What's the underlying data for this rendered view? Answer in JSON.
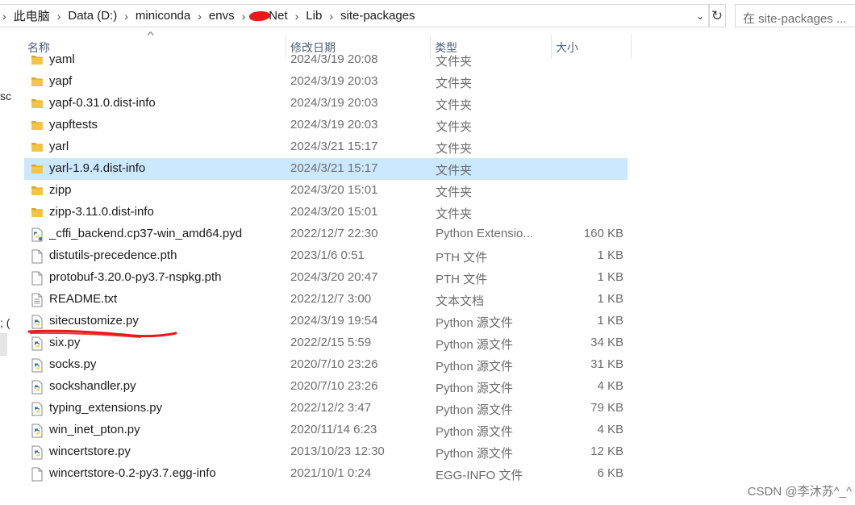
{
  "address_bar": {
    "crumbs": [
      "此电脑",
      "Data (D:)",
      "miniconda",
      "envs",
      "Net",
      "Lib",
      "site-packages"
    ]
  },
  "search": {
    "placeholder": "在 site-packages ..."
  },
  "columns": {
    "name": "名称",
    "date": "修改日期",
    "type": "类型",
    "size": "大小"
  },
  "left_nav_fragments": [
    "sc",
    "; ("
  ],
  "files": [
    {
      "name": "yaml",
      "date": "2024/3/19 20:08",
      "type": "文件夹",
      "size": "",
      "icon": "folder-icon"
    },
    {
      "name": "yapf",
      "date": "2024/3/19 20:03",
      "type": "文件夹",
      "size": "",
      "icon": "folder-icon"
    },
    {
      "name": "yapf-0.31.0.dist-info",
      "date": "2024/3/19 20:03",
      "type": "文件夹",
      "size": "",
      "icon": "folder-icon"
    },
    {
      "name": "yapftests",
      "date": "2024/3/19 20:03",
      "type": "文件夹",
      "size": "",
      "icon": "folder-icon"
    },
    {
      "name": "yarl",
      "date": "2024/3/21 15:17",
      "type": "文件夹",
      "size": "",
      "icon": "folder-icon"
    },
    {
      "name": "yarl-1.9.4.dist-info",
      "date": "2024/3/21 15:17",
      "type": "文件夹",
      "size": "",
      "icon": "folder-icon",
      "state": "hovered"
    },
    {
      "name": "zipp",
      "date": "2024/3/20 15:01",
      "type": "文件夹",
      "size": "",
      "icon": "folder-icon"
    },
    {
      "name": "zipp-3.11.0.dist-info",
      "date": "2024/3/20 15:01",
      "type": "文件夹",
      "size": "",
      "icon": "folder-icon"
    },
    {
      "name": "_cffi_backend.cp37-win_amd64.pyd",
      "date": "2022/12/7 22:30",
      "type": "Python Extensio...",
      "size": "160 KB",
      "icon": "python-extension-icon"
    },
    {
      "name": "distutils-precedence.pth",
      "date": "2023/1/6 0:51",
      "type": "PTH 文件",
      "size": "1 KB",
      "icon": "blank-file-icon"
    },
    {
      "name": "protobuf-3.20.0-py3.7-nspkg.pth",
      "date": "2024/3/20 20:47",
      "type": "PTH 文件",
      "size": "1 KB",
      "icon": "blank-file-icon"
    },
    {
      "name": "README.txt",
      "date": "2022/12/7 3:00",
      "type": "文本文档",
      "size": "1 KB",
      "icon": "text-file-icon"
    },
    {
      "name": "sitecustomize.py",
      "date": "2024/3/19 19:54",
      "type": "Python 源文件",
      "size": "1 KB",
      "icon": "python-file-icon"
    },
    {
      "name": "six.py",
      "date": "2022/2/15 5:59",
      "type": "Python 源文件",
      "size": "34 KB",
      "icon": "python-file-icon"
    },
    {
      "name": "socks.py",
      "date": "2020/7/10 23:26",
      "type": "Python 源文件",
      "size": "31 KB",
      "icon": "python-file-icon"
    },
    {
      "name": "sockshandler.py",
      "date": "2020/7/10 23:26",
      "type": "Python 源文件",
      "size": "4 KB",
      "icon": "python-file-icon"
    },
    {
      "name": "typing_extensions.py",
      "date": "2022/12/2 3:47",
      "type": "Python 源文件",
      "size": "79 KB",
      "icon": "python-file-icon"
    },
    {
      "name": "win_inet_pton.py",
      "date": "2020/11/14 6:23",
      "type": "Python 源文件",
      "size": "4 KB",
      "icon": "python-file-icon"
    },
    {
      "name": "wincertstore.py",
      "date": "2013/10/23 12:30",
      "type": "Python 源文件",
      "size": "12 KB",
      "icon": "python-file-icon"
    },
    {
      "name": "wincertstore-0.2-py3.7.egg-info",
      "date": "2021/10/1 0:24",
      "type": "EGG-INFO 文件",
      "size": "6 KB",
      "icon": "blank-file-icon"
    }
  ],
  "watermark": "CSDN @李沐苏^_^",
  "colors": {
    "folder": "#f4c542",
    "python_blue": "#3b77a8",
    "python_yellow": "#f5d33b",
    "selection": "#cce8ff",
    "annotation_red": "#e31b1b"
  }
}
